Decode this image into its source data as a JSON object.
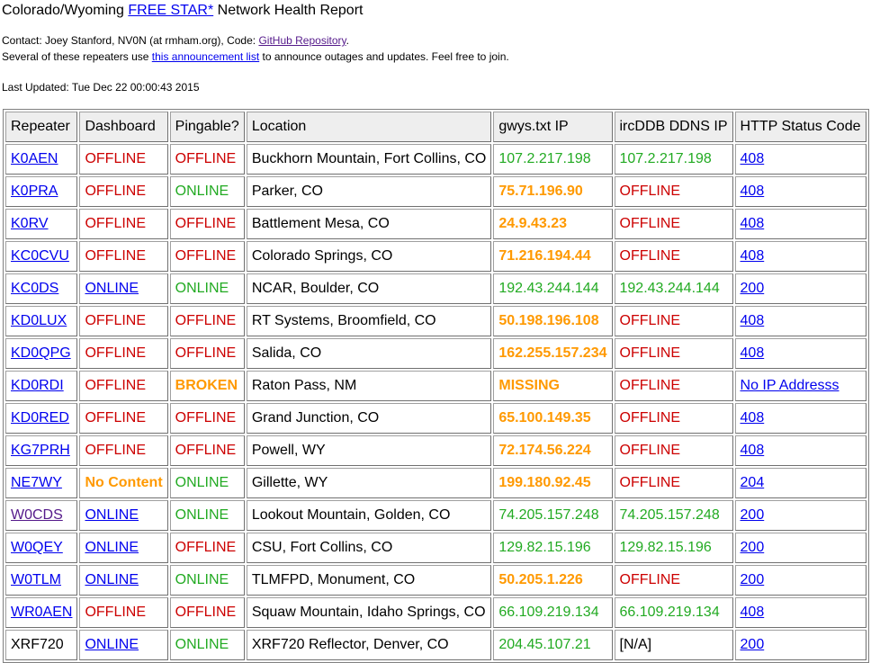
{
  "header": {
    "title_prefix": "Colorado/Wyoming ",
    "title_link": "FREE STAR*",
    "title_suffix": " Network Health Report"
  },
  "contact": {
    "prefix": "Contact: Joey Stanford, NV0N (at rmham.org), Code: ",
    "link": "GitHub Repository",
    "suffix": "."
  },
  "announce": {
    "prefix": "Several of these repeaters use ",
    "link": "this announcement list",
    "suffix": " to announce outages and updates. Feel free to join."
  },
  "last_updated": "Last Updated: Tue Dec 22 00:00:43 2015",
  "colors": {
    "offline": "#cc0000",
    "online": "#22aa22",
    "warning": "#ff9900",
    "link": "#0000ee",
    "visited_link": "#551a8b"
  },
  "table": {
    "headers": [
      "Repeater",
      "Dashboard",
      "Pingable?",
      "Location",
      "gwys.txt IP",
      "ircDDB DDNS IP",
      "HTTP Status Code"
    ],
    "rows": [
      {
        "repeater": "K0AEN",
        "repeater_link": true,
        "dashboard": "OFFLINE",
        "dashboard_style": "red",
        "pingable": "OFFLINE",
        "pingable_style": "red",
        "location": "Buckhorn Mountain, Fort Collins, CO",
        "gwys": "107.2.217.198",
        "gwys_style": "green",
        "ircddb": "107.2.217.198",
        "ircddb_style": "green",
        "http": "408"
      },
      {
        "repeater": "K0PRA",
        "repeater_link": true,
        "dashboard": "OFFLINE",
        "dashboard_style": "red",
        "pingable": "ONLINE",
        "pingable_style": "green",
        "location": "Parker, CO",
        "gwys": "75.71.196.90",
        "gwys_style": "orange",
        "ircddb": "OFFLINE",
        "ircddb_style": "red",
        "http": "408"
      },
      {
        "repeater": "K0RV",
        "repeater_link": true,
        "dashboard": "OFFLINE",
        "dashboard_style": "red",
        "pingable": "OFFLINE",
        "pingable_style": "red",
        "location": "Battlement Mesa, CO",
        "gwys": "24.9.43.23",
        "gwys_style": "orange",
        "ircddb": "OFFLINE",
        "ircddb_style": "red",
        "http": "408"
      },
      {
        "repeater": "KC0CVU",
        "repeater_link": true,
        "dashboard": "OFFLINE",
        "dashboard_style": "red",
        "pingable": "OFFLINE",
        "pingable_style": "red",
        "location": "Colorado Springs, CO",
        "gwys": "71.216.194.44",
        "gwys_style": "orange",
        "ircddb": "OFFLINE",
        "ircddb_style": "red",
        "http": "408"
      },
      {
        "repeater": "KC0DS",
        "repeater_link": true,
        "dashboard": "ONLINE",
        "dashboard_style": "link",
        "pingable": "ONLINE",
        "pingable_style": "green",
        "location": "NCAR, Boulder, CO",
        "gwys": "192.43.244.144",
        "gwys_style": "green",
        "ircddb": "192.43.244.144",
        "ircddb_style": "green",
        "http": "200"
      },
      {
        "repeater": "KD0LUX",
        "repeater_link": true,
        "dashboard": "OFFLINE",
        "dashboard_style": "red",
        "pingable": "OFFLINE",
        "pingable_style": "red",
        "location": "RT Systems, Broomfield, CO",
        "gwys": "50.198.196.108",
        "gwys_style": "orange",
        "ircddb": "OFFLINE",
        "ircddb_style": "red",
        "http": "408"
      },
      {
        "repeater": "KD0QPG",
        "repeater_link": true,
        "dashboard": "OFFLINE",
        "dashboard_style": "red",
        "pingable": "OFFLINE",
        "pingable_style": "red",
        "location": "Salida, CO",
        "gwys": "162.255.157.234",
        "gwys_style": "orange",
        "ircddb": "OFFLINE",
        "ircddb_style": "red",
        "http": "408"
      },
      {
        "repeater": "KD0RDI",
        "repeater_link": true,
        "dashboard": "OFFLINE",
        "dashboard_style": "red",
        "pingable": "BROKEN",
        "pingable_style": "orange",
        "location": "Raton Pass, NM",
        "gwys": "MISSING",
        "gwys_style": "orange",
        "ircddb": "OFFLINE",
        "ircddb_style": "red",
        "http": "No IP Addresss"
      },
      {
        "repeater": "KD0RED",
        "repeater_link": true,
        "dashboard": "OFFLINE",
        "dashboard_style": "red",
        "pingable": "OFFLINE",
        "pingable_style": "red",
        "location": "Grand Junction, CO",
        "gwys": "65.100.149.35",
        "gwys_style": "orange",
        "ircddb": "OFFLINE",
        "ircddb_style": "red",
        "http": "408"
      },
      {
        "repeater": "KG7PRH",
        "repeater_link": true,
        "dashboard": "OFFLINE",
        "dashboard_style": "red",
        "pingable": "OFFLINE",
        "pingable_style": "red",
        "location": "Powell, WY",
        "gwys": "72.174.56.224",
        "gwys_style": "orange",
        "ircddb": "OFFLINE",
        "ircddb_style": "red",
        "http": "408"
      },
      {
        "repeater": "NE7WY",
        "repeater_link": true,
        "dashboard": "No Content",
        "dashboard_style": "orange",
        "pingable": "ONLINE",
        "pingable_style": "green",
        "location": "Gillette, WY",
        "gwys": "199.180.92.45",
        "gwys_style": "orange",
        "ircddb": "OFFLINE",
        "ircddb_style": "red",
        "http": "204"
      },
      {
        "repeater": "W0CDS",
        "repeater_link": true,
        "repeater_visited": true,
        "dashboard": "ONLINE",
        "dashboard_style": "link",
        "pingable": "ONLINE",
        "pingable_style": "green",
        "location": "Lookout Mountain, Golden, CO",
        "gwys": "74.205.157.248",
        "gwys_style": "green",
        "ircddb": "74.205.157.248",
        "ircddb_style": "green",
        "http": "200"
      },
      {
        "repeater": "W0QEY",
        "repeater_link": true,
        "dashboard": "ONLINE",
        "dashboard_style": "link",
        "pingable": "OFFLINE",
        "pingable_style": "red",
        "location": "CSU, Fort Collins, CO",
        "gwys": "129.82.15.196",
        "gwys_style": "green",
        "ircddb": "129.82.15.196",
        "ircddb_style": "green",
        "http": "200"
      },
      {
        "repeater": "W0TLM",
        "repeater_link": true,
        "dashboard": "ONLINE",
        "dashboard_style": "link",
        "pingable": "ONLINE",
        "pingable_style": "green",
        "location": "TLMFPD, Monument, CO",
        "gwys": "50.205.1.226",
        "gwys_style": "orange",
        "ircddb": "OFFLINE",
        "ircddb_style": "red",
        "http": "200"
      },
      {
        "repeater": "WR0AEN",
        "repeater_link": true,
        "dashboard": "OFFLINE",
        "dashboard_style": "red",
        "pingable": "OFFLINE",
        "pingable_style": "red",
        "location": "Squaw Mountain, Idaho Springs, CO",
        "gwys": "66.109.219.134",
        "gwys_style": "green",
        "ircddb": "66.109.219.134",
        "ircddb_style": "green",
        "http": "408"
      },
      {
        "repeater": "XRF720",
        "repeater_link": false,
        "dashboard": "ONLINE",
        "dashboard_style": "link",
        "pingable": "ONLINE",
        "pingable_style": "green",
        "location": "XRF720 Reflector, Denver, CO",
        "gwys": "204.45.107.21",
        "gwys_style": "green",
        "ircddb": "[N/A]",
        "ircddb_style": "black",
        "http": "200"
      }
    ]
  }
}
